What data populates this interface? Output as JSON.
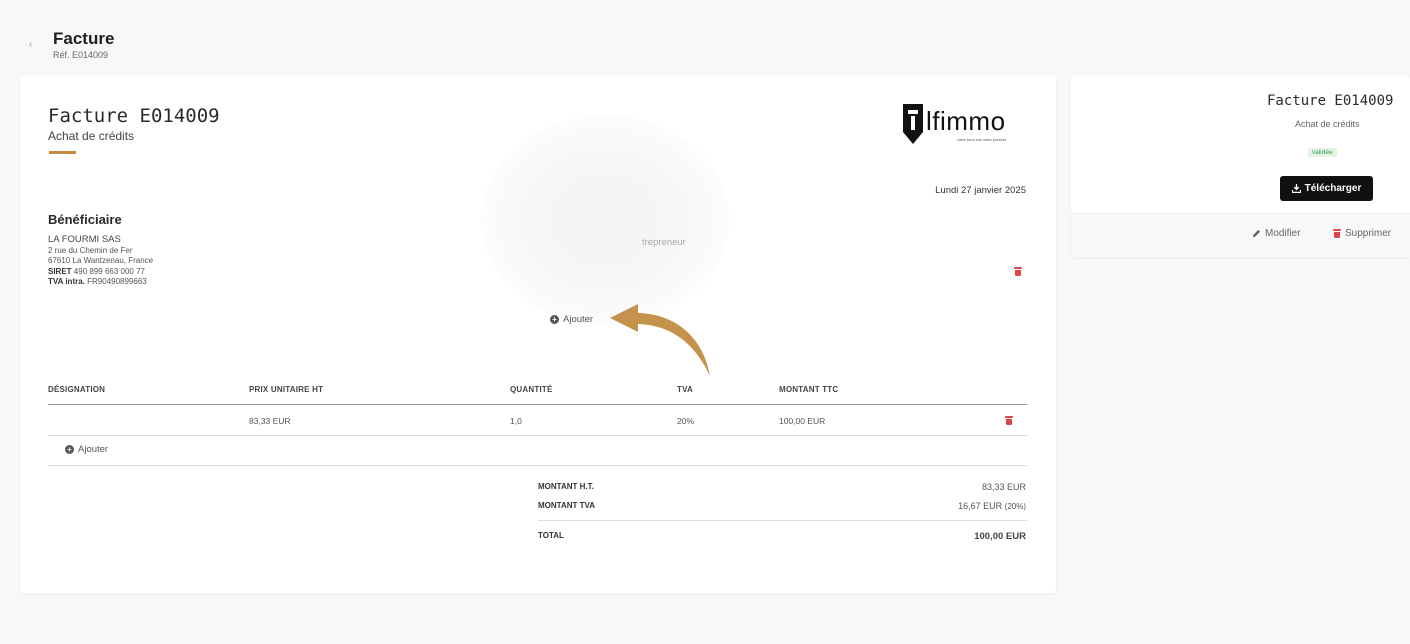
{
  "header": {
    "back": "‹",
    "title": "Facture",
    "ref": "Réf. E014009"
  },
  "invoice": {
    "title": "Facture E014009",
    "subtitle": "Achat de crédits",
    "logo_text": "lfimmo",
    "logo_tagline": "votre futur est notre présent",
    "date": "Lundi 27 janvier 2025",
    "beneficiary": {
      "heading": "Bénéficiaire",
      "name": "LA FOURMI SAS",
      "address1": "2 rue du Chemin de Fer",
      "address2": "67610 La Wantzenau, France",
      "siret_label": "SIRET",
      "siret": "490 899 663 000 77",
      "tva_label": "TVA intra.",
      "tva": "FR90490899663"
    },
    "blurred_fragment": "trepreneur",
    "add_label": "Ajouter",
    "table": {
      "headers": [
        "DÉSIGNATION",
        "PRIX UNITAIRE HT",
        "QUANTITÉ",
        "TVA",
        "MONTANT TTC"
      ],
      "rows": [
        {
          "designation": "",
          "unit_price": "83,33 EUR",
          "quantity": "1,0",
          "tva": "20%",
          "ttc": "100,00 EUR"
        }
      ],
      "add_label": "Ajouter"
    },
    "totals": {
      "ht_label": "MONTANT H.T.",
      "ht_value": "83,33 EUR",
      "tva_label": "MONTANT TVA",
      "tva_value": "16,67 EUR",
      "tva_rate": "(20%)",
      "total_label": "TOTAL",
      "total_value": "100,00 EUR"
    }
  },
  "side": {
    "title": "Facture E014009",
    "subtitle": "Achat de crédits",
    "status": "validée",
    "download": "Télécharger",
    "edit": "Modifier",
    "delete": "Supprimer"
  },
  "colors": {
    "accent": "#c9883a",
    "danger": "#e04545",
    "success": "#3c9c52",
    "arrow": "#c4924a"
  }
}
